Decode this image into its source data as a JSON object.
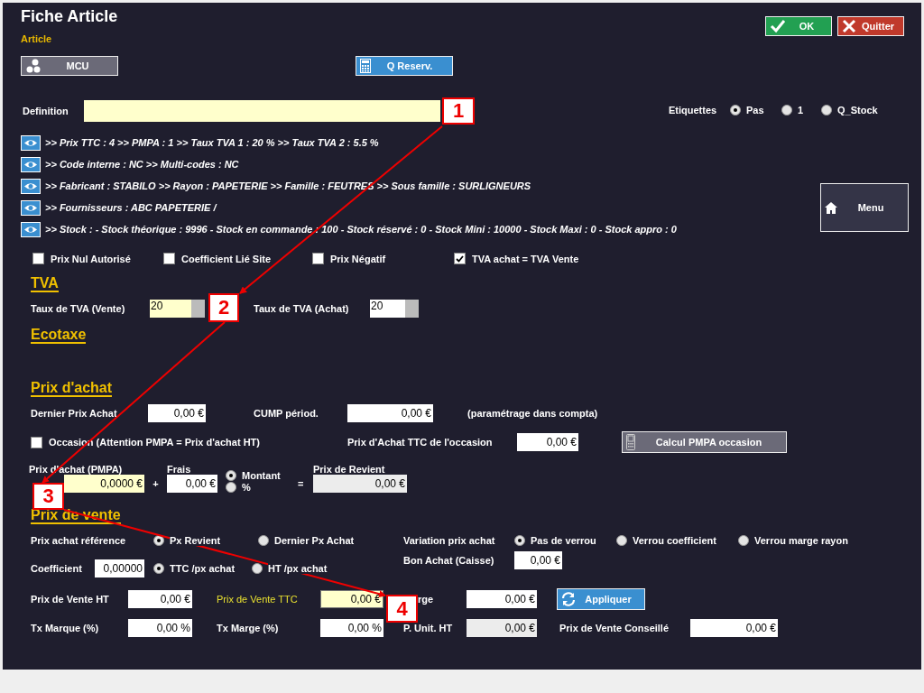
{
  "window": {
    "title": "Fiche Article",
    "subtitle": "Article"
  },
  "actions": [
    {
      "label": "OK",
      "kind": "ok"
    },
    {
      "label": "Quitter",
      "kind": "quit"
    }
  ],
  "tools": [
    {
      "label": "MCU",
      "kind": "dots"
    },
    {
      "label": "Q Reserv.",
      "kind": "calculator"
    }
  ],
  "definition": {
    "label": "Definition",
    "kind": "highlight"
  },
  "etiquettes": {
    "label": "Etiquettes",
    "options": [
      {
        "label": "Pas",
        "selected": true
      },
      {
        "label": "1",
        "selected": false
      },
      {
        "label": "Q_Stock",
        "selected": false
      }
    ]
  },
  "info_lines": [
    ">> Prix TTC : 4 >> PMPA : 1 >> Taux TVA 1 : 20 %  >> Taux TVA 2 : 5.5 %",
    ">> Code interne : NC  >> Multi-codes :  NC",
    ">> Fabricant  : STABILO  >> Rayon : PAPETERIE  >> Famille : FEUTRES  >> Sous famille : SURLIGNEURS",
    ">> Fournisseurs : ABC PAPETERIE /",
    ">> Stock :  - Stock théorique : 9996 - Stock en commande : 100 - Stock réservé : 0 - Stock Mini : 10000 - Stock Maxi : 0 - Stock appro : 0"
  ],
  "menu_button": "Menu",
  "flags": [
    {
      "label": "Prix Nul Autorisé",
      "checked": false
    },
    {
      "label": "Coefficient Lié Site",
      "checked": false
    },
    {
      "label": "Prix Négatif",
      "checked": false
    },
    {
      "label": "TVA achat = TVA Vente",
      "checked": true
    }
  ],
  "tva": {
    "heading": "TVA",
    "fields": [
      {
        "label": "Taux de TVA (Vente)",
        "value": "20",
        "kind": "highlight"
      },
      {
        "label": "Taux de TVA (Achat)",
        "value": "20",
        "kind": "normal"
      }
    ]
  },
  "ecotaxe": {
    "heading": "Ecotaxe"
  },
  "prix_achat": {
    "heading": "Prix d'achat",
    "dernier": {
      "label": "Dernier Prix Achat",
      "value": "0,00 €"
    },
    "cump": {
      "label": "CUMP périod.",
      "value": "0,00 €"
    },
    "note": "(paramétrage dans compta)",
    "occasion": {
      "label": "Occasion (Attention PMPA = Prix d'achat HT)",
      "checked": false
    },
    "occasion_ttc": {
      "label": "Prix d'Achat TTC de l'occasion",
      "value": "0,00 €"
    },
    "calc_button": "Calcul PMPA occasion",
    "pmpa": {
      "label": "Prix d'achat (PMPA)",
      "value": "0,0000 €",
      "kind": "highlight"
    },
    "plus": "+",
    "frais": {
      "label": "Frais",
      "value": "0,00 €"
    },
    "frais_mode": [
      {
        "label": "Montant",
        "selected": true
      },
      {
        "label": "%",
        "selected": false
      }
    ],
    "equals": "=",
    "revient": {
      "label": "Prix de Revient",
      "value": "0,00 €",
      "kind": "readonly"
    }
  },
  "prix_vente": {
    "heading": "Prix de vente",
    "reference": {
      "label": "Prix achat référence",
      "options": [
        {
          "label": "Px Revient",
          "selected": true
        },
        {
          "label": "Dernier Px Achat",
          "selected": false
        }
      ]
    },
    "variation": {
      "label": "Variation prix achat",
      "options": [
        {
          "label": "Pas de verrou",
          "selected": true
        },
        {
          "label": "Verrou coefficient",
          "selected": false
        },
        {
          "label": "Verrou marge rayon",
          "selected": false
        }
      ]
    },
    "bon_achat": {
      "label": "Bon Achat (Caisse)",
      "value": "0,00 €"
    },
    "coefficient": {
      "label": "Coefficient",
      "value": "0,00000",
      "options": [
        {
          "label": "TTC /px achat",
          "selected": true
        },
        {
          "label": "HT /px achat",
          "selected": false
        }
      ]
    },
    "pv_ht": {
      "label": "Prix de Vente HT",
      "value": "0,00 €"
    },
    "pv_ttc": {
      "label": "Prix de Vente TTC",
      "value": "0,00 €",
      "kind": "focus"
    },
    "marge": {
      "label": "rge",
      "value": "0,00 €"
    },
    "apply_button": "Appliquer",
    "tx_marque": {
      "label": "Tx Marque (%)",
      "value": "0,00 %"
    },
    "tx_marge": {
      "label": "Tx Marge (%)",
      "value": "0,00 %"
    },
    "unit_ht": {
      "label": "P. Unit. HT",
      "value": "0,00 €",
      "kind": "readonly"
    },
    "conseille": {
      "label": "Prix de Vente Conseillé",
      "value": "0,00 €"
    }
  },
  "callouts": [
    "1",
    "2",
    "3",
    "4"
  ]
}
